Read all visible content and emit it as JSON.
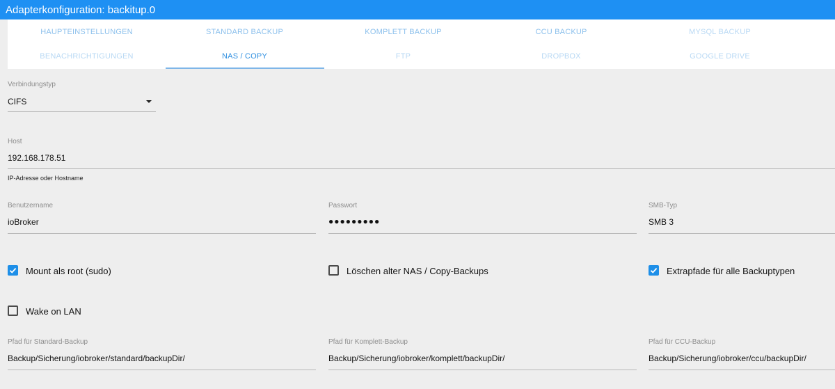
{
  "window": {
    "title": "Adapterkonfiguration: backitup.0"
  },
  "tabs": {
    "row1": [
      "HAUPTEINSTELLUNGEN",
      "STANDARD BACKUP",
      "KOMPLETT BACKUP",
      "CCU BACKUP",
      "MYSQL BACKUP"
    ],
    "row2": [
      "BENACHRICHTIGUNGEN",
      "NAS / COPY",
      "FTP",
      "DROPBOX",
      "GOOGLE DRIVE"
    ],
    "active": "NAS / COPY"
  },
  "form": {
    "verbindungstyp": {
      "label": "Verbindungstyp",
      "value": "CIFS"
    },
    "host": {
      "label": "Host",
      "value": "192.168.178.51",
      "helper": "IP-Adresse oder Hostname"
    },
    "benutzername": {
      "label": "Benutzername",
      "value": "ioBroker"
    },
    "passwort": {
      "label": "Passwort",
      "value": "●●●●●●●●●"
    },
    "smb_typ": {
      "label": "SMB-Typ",
      "value": "SMB 3"
    },
    "mount_root": {
      "label": "Mount als root (sudo)",
      "checked": true
    },
    "loeschen": {
      "label": "Löschen alter NAS / Copy-Backups",
      "checked": false
    },
    "extrapfade": {
      "label": "Extrapfade für alle Backuptypen",
      "checked": true
    },
    "wake_on_lan": {
      "label": "Wake on LAN",
      "checked": false
    },
    "pfad_standard": {
      "label": "Pfad für Standard-Backup",
      "value": "Backup/Sicherung/iobroker/standard/backupDir/"
    },
    "pfad_komplett": {
      "label": "Pfad für Komplett-Backup",
      "value": "Backup/Sicherung/iobroker/komplett/backupDir/"
    },
    "pfad_ccu": {
      "label": "Pfad für CCU-Backup",
      "value": "Backup/Sicherung/iobroker/ccu/backupDir/"
    }
  },
  "colors": {
    "accent": "#1e90f3",
    "checkbox": "#1e8fe8"
  }
}
